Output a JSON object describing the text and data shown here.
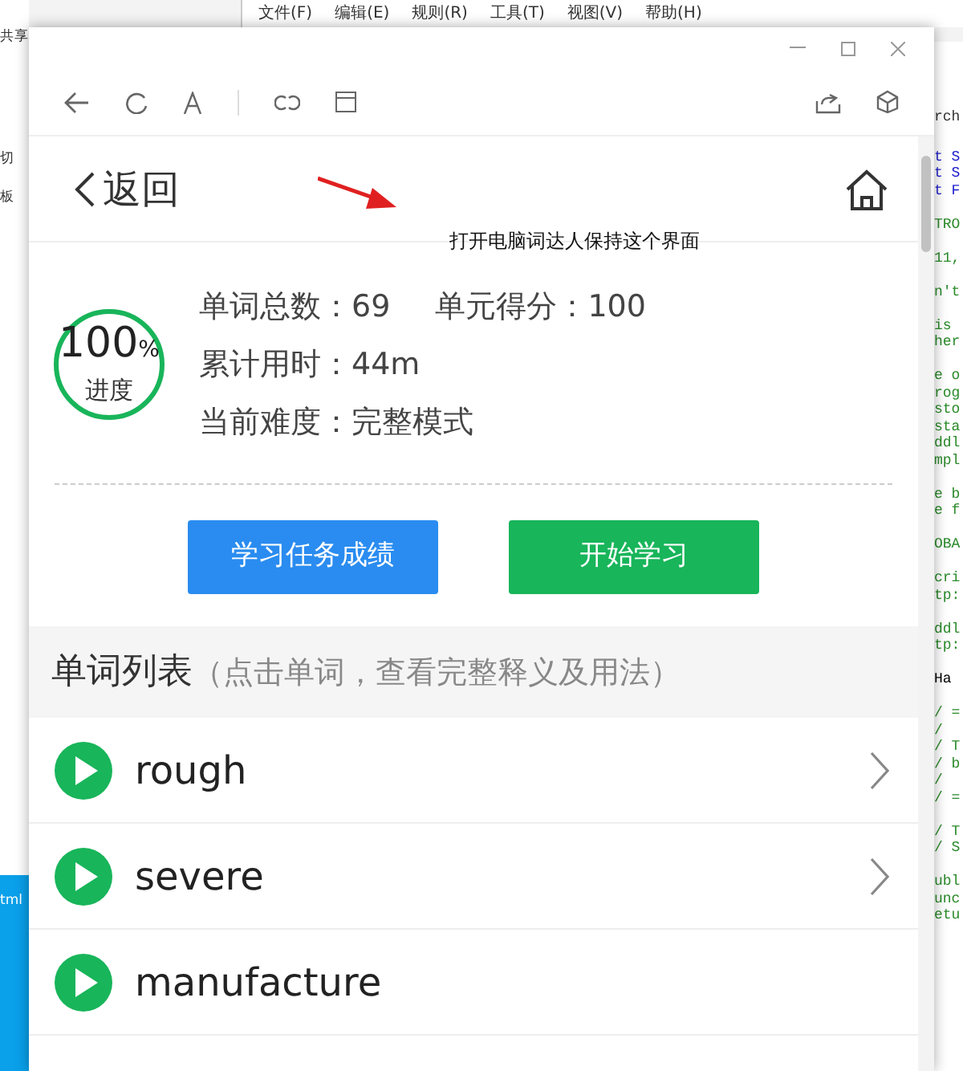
{
  "background_editor": {
    "menu": [
      "文件(F)",
      "编辑(E)",
      "规则(R)",
      "工具(T)",
      "视图(V)",
      "帮助(H)"
    ],
    "left_fragments": [
      "共享",
      "切",
      "板",
      "tml"
    ],
    "right_header": "rch",
    "right_code_blocks": [
      [
        "t S",
        "t S",
        "t F"
      ],
      [
        "TRO"
      ],
      [
        "11,"
      ],
      [
        "n't"
      ],
      [
        "is",
        "her"
      ],
      [
        "e o",
        "rog",
        "sto",
        "sta",
        "ddl",
        "mpl"
      ],
      [
        "e b",
        "e f"
      ],
      [
        "OBA"
      ],
      [
        "cri",
        "tp:"
      ],
      [
        "ddl",
        "tp:"
      ],
      [
        "Ha"
      ],
      [
        "/ =",
        "/",
        "/ T",
        "/ b",
        "/",
        "/ ="
      ],
      [
        "/ T",
        "/ S"
      ],
      [
        "ubl",
        "unc",
        "etu"
      ]
    ]
  },
  "app": {
    "header": {
      "back_label": "返回"
    },
    "annotation": "打开电脑词达人保持这个界面",
    "progress": {
      "percent": "100",
      "unit": "%",
      "label": "进度",
      "level": 1
    },
    "stats": [
      {
        "label": "单词总数：",
        "value": "69"
      },
      {
        "label": "单元得分：",
        "value": "100"
      },
      {
        "label": "累计用时：",
        "value": "44m"
      },
      {
        "label": "当前难度：",
        "value": "完整模式"
      }
    ],
    "buttons": [
      {
        "label": "学习任务成绩",
        "kind": "primary"
      },
      {
        "label": "开始学习",
        "kind": "success"
      }
    ],
    "word_list": {
      "title": "单词列表",
      "hint": "（点击单词，查看完整释义及用法）",
      "words": [
        {
          "word": "rough",
          "chevron": true
        },
        {
          "word": "severe",
          "chevron": true
        },
        {
          "word": "manufacture",
          "chevron": false
        }
      ]
    }
  }
}
